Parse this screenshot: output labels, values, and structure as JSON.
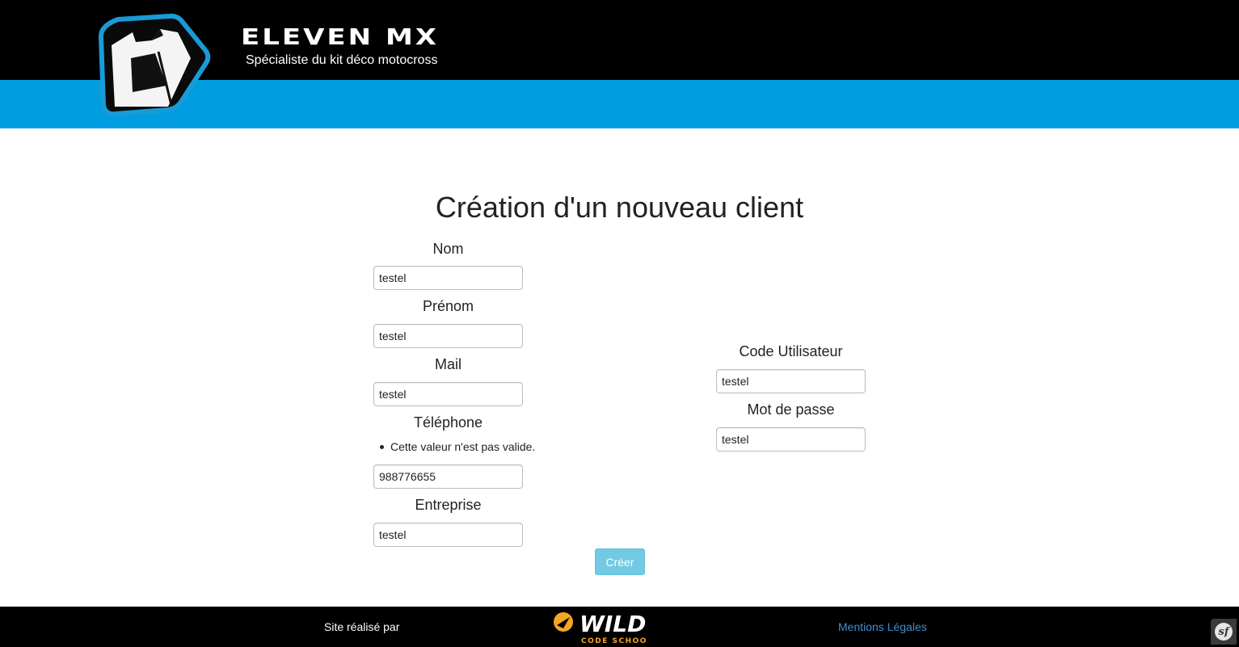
{
  "header": {
    "brand": "ELEVEN MX",
    "tagline": "Spécialiste du kit déco motocross",
    "colors": {
      "top": "#000000",
      "band": "#009ee0"
    }
  },
  "main": {
    "title": "Création d'un nouveau client",
    "left_fields": [
      {
        "label": "Nom",
        "value": "testel"
      },
      {
        "label": "Prénom",
        "value": "testel"
      },
      {
        "label": "Mail",
        "value": "testel"
      },
      {
        "label": "Téléphone",
        "value": "988776655",
        "error": "Cette valeur n'est pas valide."
      },
      {
        "label": "Entreprise",
        "value": "testel"
      }
    ],
    "right_fields": [
      {
        "label": "Code Utilisateur",
        "value": "testel"
      },
      {
        "label": "Mot de passe",
        "value": "testel"
      }
    ],
    "submit_label": "Créer"
  },
  "footer": {
    "credit": "Site réalisé par",
    "partner_logo": {
      "word": "WILD",
      "sub": "CODE SCHOOL"
    },
    "legal_link": "Mentions Légales",
    "framework_badge": "sf"
  }
}
